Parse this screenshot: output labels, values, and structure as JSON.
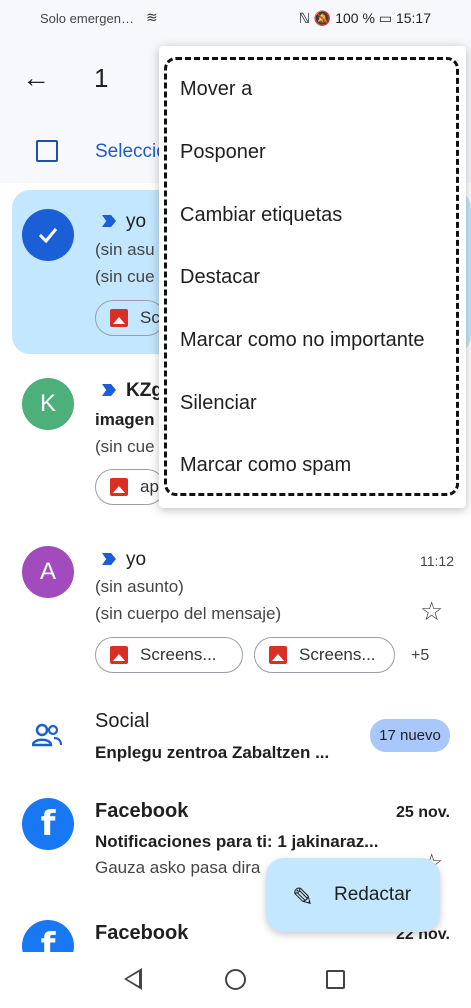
{
  "status": {
    "carrier": "Solo emergen…",
    "icons": "ℕ 🔕",
    "battery": "100 %",
    "time": "15:17"
  },
  "appbar": {
    "selected_count": "1",
    "select_all_label": "Seleccio"
  },
  "menu": {
    "items": [
      "Mover a",
      "Posponer",
      "Cambiar etiquetas",
      "Destacar",
      "Marcar como no importante",
      "Silenciar",
      "Marcar como spam"
    ]
  },
  "emails": [
    {
      "sender": "yo",
      "subject": "(sin asu",
      "body": "(sin cue",
      "chip": "Sc",
      "selected": true
    },
    {
      "avatar_letter": "K",
      "avatar_color": "#4db07b",
      "sender": "KZg",
      "subject": "imagen",
      "body": "(sin cue",
      "chip": "ap"
    },
    {
      "avatar_letter": "A",
      "avatar_color": "#a24bbd",
      "sender": "yo",
      "time": "11:12",
      "subject": "(sin asunto)",
      "body": "(sin cuerpo del mensaje)",
      "chips": [
        "Screens...",
        "Screens..."
      ],
      "more_count": "+5"
    }
  ],
  "social": {
    "title": "Social",
    "preview": "Enplegu zentroa Zabaltzen ...",
    "badge": "17 nuevo"
  },
  "facebook1": {
    "avatar_letter": "f",
    "sender": "Facebook",
    "date": "25 nov.",
    "subject": "Notificaciones para ti: 1 jakinaraz...",
    "preview": "Gauza asko pasa dira"
  },
  "facebook2": {
    "avatar_letter": "f",
    "sender": "Facebook",
    "date": "22 nov."
  },
  "fab": {
    "label": "Redactar"
  },
  "colors": {
    "accent": "#1a5fd6",
    "selected_bg": "#c2e7ff",
    "badge_bg": "#a8c7fa",
    "facebook": "#1877f2"
  }
}
